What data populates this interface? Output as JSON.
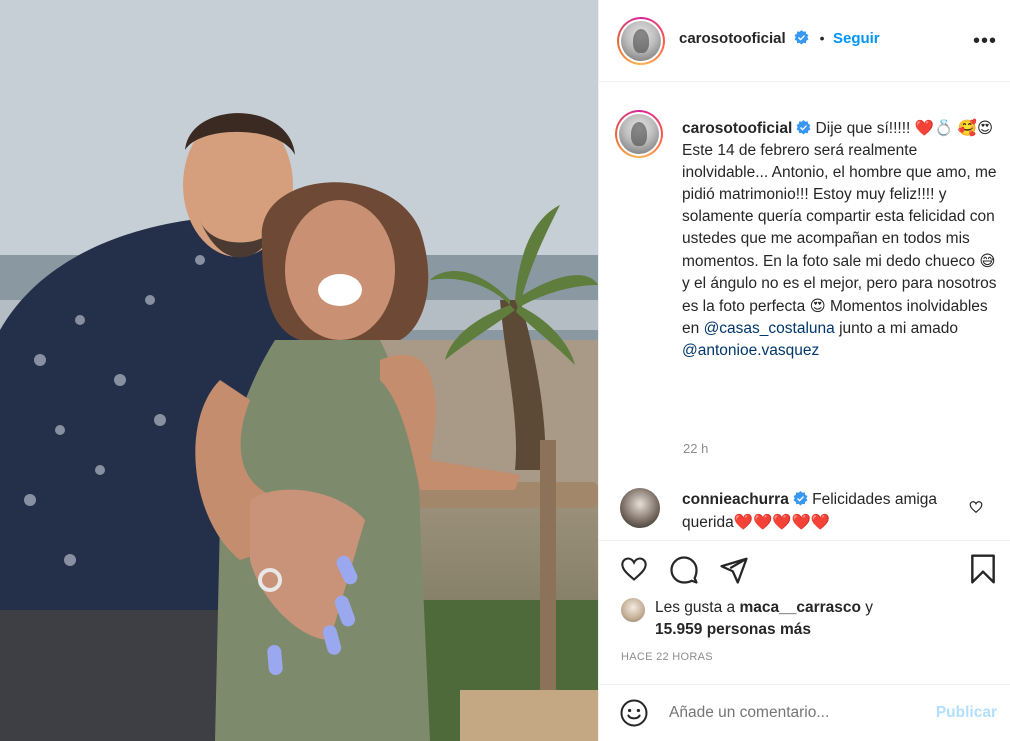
{
  "post": {
    "author": "carosotooficial",
    "follow_label": "Seguir",
    "dot": "•",
    "more_label": "•••",
    "caption": {
      "author": "carosotooficial",
      "text_1": " Dije que sí!!!!! ",
      "emoji_1": "❤️💍",
      "emoji_2": "🥰😍",
      "text_2": "Este 14 de febrero será realmente inolvidable... Antonio, el hombre que amo, me pidió matrimonio!!! Estoy muy feliz!!!! y solamente quería compartir esta felicidad con ustedes que me acompañan en todos mis momentos. En la foto sale mi dedo chueco ",
      "emoji_3": "😅",
      "text_3": " y el ángulo no es el mejor, pero para nosotros es la foto perfecta ",
      "emoji_4": "😍",
      "text_4": " Momentos inolvidables en ",
      "mention_1": "@casas_costaluna",
      "text_5": " junto a mi amado ",
      "mention_2": "@antonioe.vasquez"
    },
    "time_ago": "22 h",
    "comments": [
      {
        "author": "connieachurra",
        "text": "Felicidades amiga querida",
        "emoji": "❤️❤️❤️❤️❤️"
      }
    ],
    "likes": {
      "prefix": "Les gusta a ",
      "user": "maca__carrasco",
      "connector": " y",
      "count_text": "15.959 personas más"
    },
    "timestamp": "Hace 22 horas",
    "comment_placeholder": "Añade un comentario...",
    "publish_label": "Publicar"
  },
  "colors": {
    "accent": "#0095f6",
    "mention": "#00376b",
    "muted": "#8e8e8e",
    "publish_disabled": "#b2dffc",
    "heart": "#ed4956"
  },
  "icons": {
    "header_more": "more-icon",
    "verified": "verified-badge-icon",
    "like": "heart-icon",
    "comment": "comment-icon",
    "share": "share-icon",
    "save": "bookmark-icon",
    "emoji_picker": "smiley-icon"
  }
}
